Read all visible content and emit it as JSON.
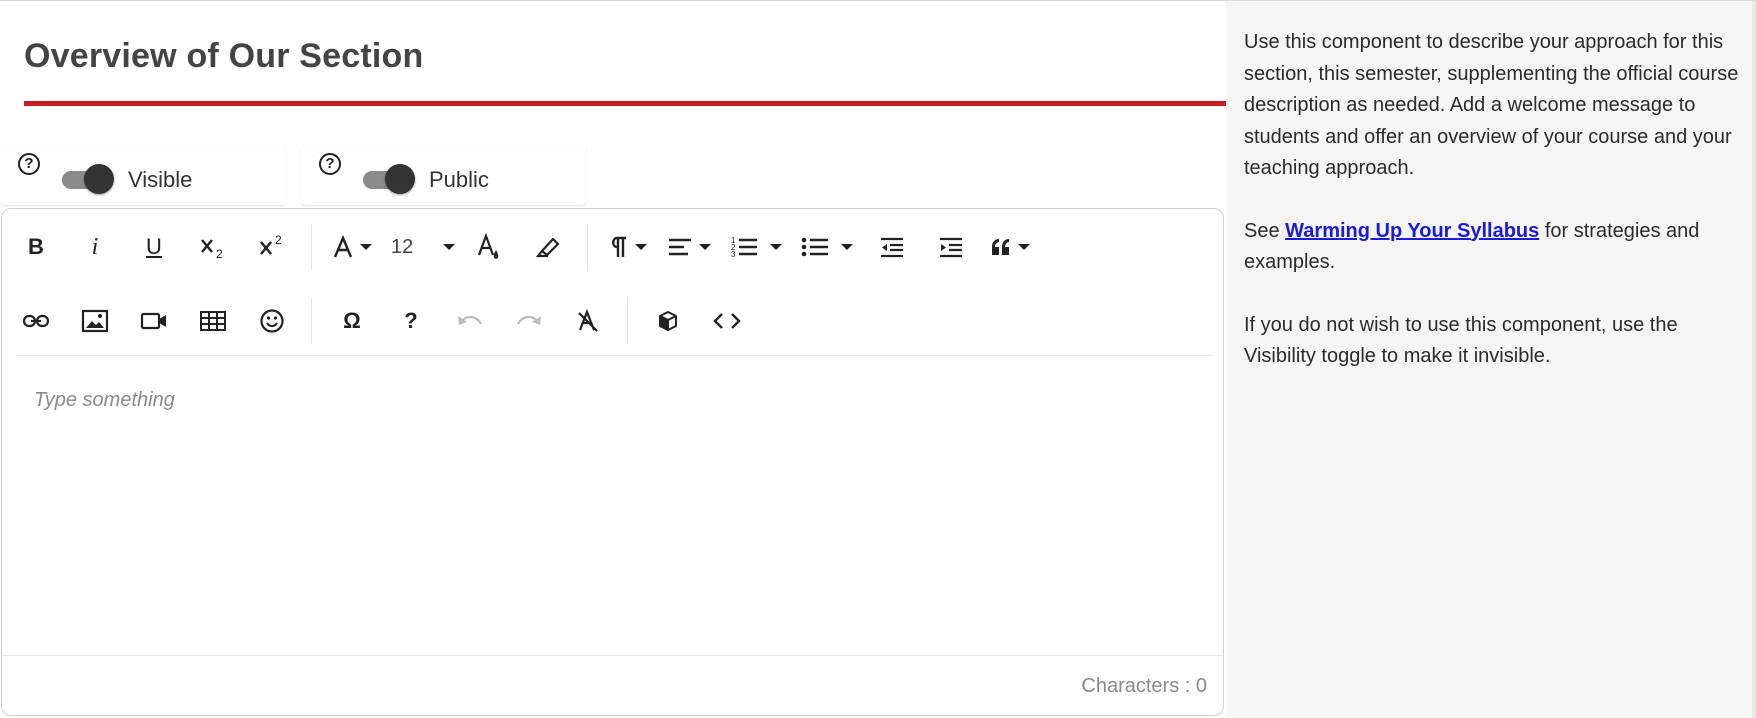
{
  "section": {
    "title": "Overview of Our Section",
    "rule_color": "#c41f1f"
  },
  "toggles": [
    {
      "label": "Visible",
      "state": "on",
      "help": "?"
    },
    {
      "label": "Public",
      "state": "on",
      "help": "?"
    }
  ],
  "toolbar": {
    "row1": [
      "bold",
      "italic",
      "underline",
      "subscript",
      "superscript",
      "font-family",
      "font-size",
      "text-color",
      "highlight",
      "paragraph-format",
      "align",
      "ordered-list",
      "unordered-list",
      "outdent",
      "indent",
      "quote"
    ],
    "row2": [
      "insert-link",
      "insert-image",
      "insert-video",
      "insert-table",
      "emoticons",
      "special-characters",
      "help",
      "undo",
      "redo",
      "clear-formatting",
      "embed",
      "code-view"
    ],
    "bold": "B",
    "italic": "i",
    "underline": "U",
    "font_size": "12",
    "omega": "Ω",
    "help": "?"
  },
  "editor": {
    "placeholder": "Type something",
    "char_count": "Characters : 0"
  },
  "sidebar": {
    "p1": "Use this component to describe your approach for this section, this semester, supplementing the official course description as needed. Add a welcome message to students and offer an overview of your course and your teaching approach.",
    "p2_before": "See ",
    "p2_link": "Warming Up Your Syllabus",
    "p2_after": " for strategies and examples.",
    "p3": "If you do not wish to use this component, use the Visibility toggle to make it invisible."
  },
  "colors": {
    "link": "#1a1adb",
    "toggle_knob": "#333333",
    "toggle_track": "#8a8a8a",
    "sidebar_bg": "#f5f5f5"
  }
}
